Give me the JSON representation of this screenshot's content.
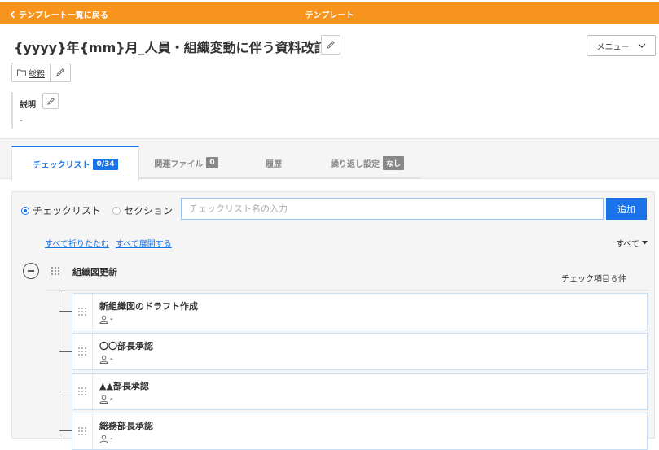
{
  "topbar": {
    "back_label": "テンプレート一覧に戻る",
    "title": "テンプレート"
  },
  "page": {
    "title": "{yyyy}年{mm}月_人員・組織変動に伴う資料改訂",
    "menu_label": "メニュー"
  },
  "folder": {
    "label": "総務"
  },
  "description": {
    "label": "説明",
    "value": "-"
  },
  "tabs": [
    {
      "label": "チェックリスト",
      "badge": "0/34"
    },
    {
      "label": "関連ファイル",
      "badge": "0"
    },
    {
      "label": "履歴",
      "badge": ""
    },
    {
      "label": "繰り返し設定",
      "badge": "なし"
    }
  ],
  "toolbar": {
    "radio_checklist": "チェックリスト",
    "radio_section": "セクション",
    "search_placeholder": "チェックリスト名の入力",
    "add_label": "追加",
    "collapse_all": "すべて折りたたむ",
    "expand_all": "すべて展開する",
    "filter_label": "すべて"
  },
  "section": {
    "title": "組織図更新",
    "count": "チェック項目６件"
  },
  "items": [
    {
      "title": "新組織図のドラフト作成",
      "assignee": "-"
    },
    {
      "title": "〇〇部長承認",
      "assignee": "-"
    },
    {
      "title": "▲▲部長承認",
      "assignee": "-"
    },
    {
      "title": "総務部長承認",
      "assignee": "-"
    }
  ],
  "colors": {
    "accent": "#f7941d",
    "primary": "#1a73e8"
  }
}
